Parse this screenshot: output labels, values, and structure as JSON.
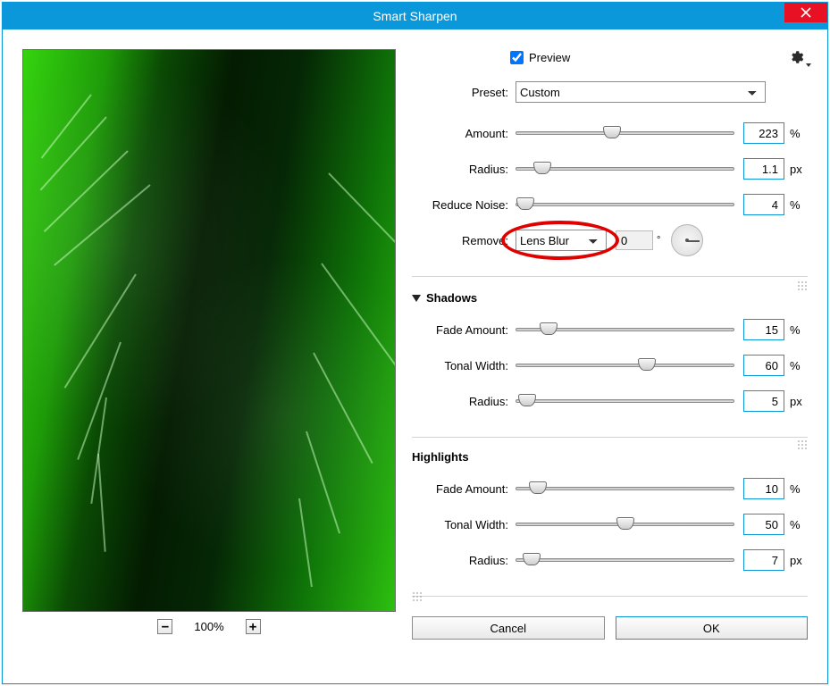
{
  "window": {
    "title": "Smart Sharpen"
  },
  "preview": {
    "label": "Preview",
    "checked": true,
    "zoom_label": "100%"
  },
  "preset": {
    "label": "Preset:",
    "value": "Custom"
  },
  "main": {
    "amount": {
      "label": "Amount:",
      "value": "223",
      "unit": "%",
      "pos": 44
    },
    "radius": {
      "label": "Radius:",
      "value": "1.1",
      "unit": "px",
      "pos": 12
    },
    "reduce_noise": {
      "label": "Reduce Noise:",
      "value": "4",
      "unit": "%",
      "pos": 4
    }
  },
  "remove": {
    "label": "Remove:",
    "value": "Lens Blur",
    "angle": "0"
  },
  "shadows": {
    "title": "Shadows",
    "fade_amount": {
      "label": "Fade Amount:",
      "value": "15",
      "unit": "%",
      "pos": 15
    },
    "tonal_width": {
      "label": "Tonal Width:",
      "value": "60",
      "unit": "%",
      "pos": 60
    },
    "radius": {
      "label": "Radius:",
      "value": "5",
      "unit": "px",
      "pos": 5
    }
  },
  "highlights": {
    "title": "Highlights",
    "fade_amount": {
      "label": "Fade Amount:",
      "value": "10",
      "unit": "%",
      "pos": 10
    },
    "tonal_width": {
      "label": "Tonal Width:",
      "value": "50",
      "unit": "%",
      "pos": 50
    },
    "radius": {
      "label": "Radius:",
      "value": "7",
      "unit": "px",
      "pos": 7
    }
  },
  "buttons": {
    "cancel": "Cancel",
    "ok": "OK"
  },
  "annotation": {
    "ellipse_on": "remove-select"
  }
}
